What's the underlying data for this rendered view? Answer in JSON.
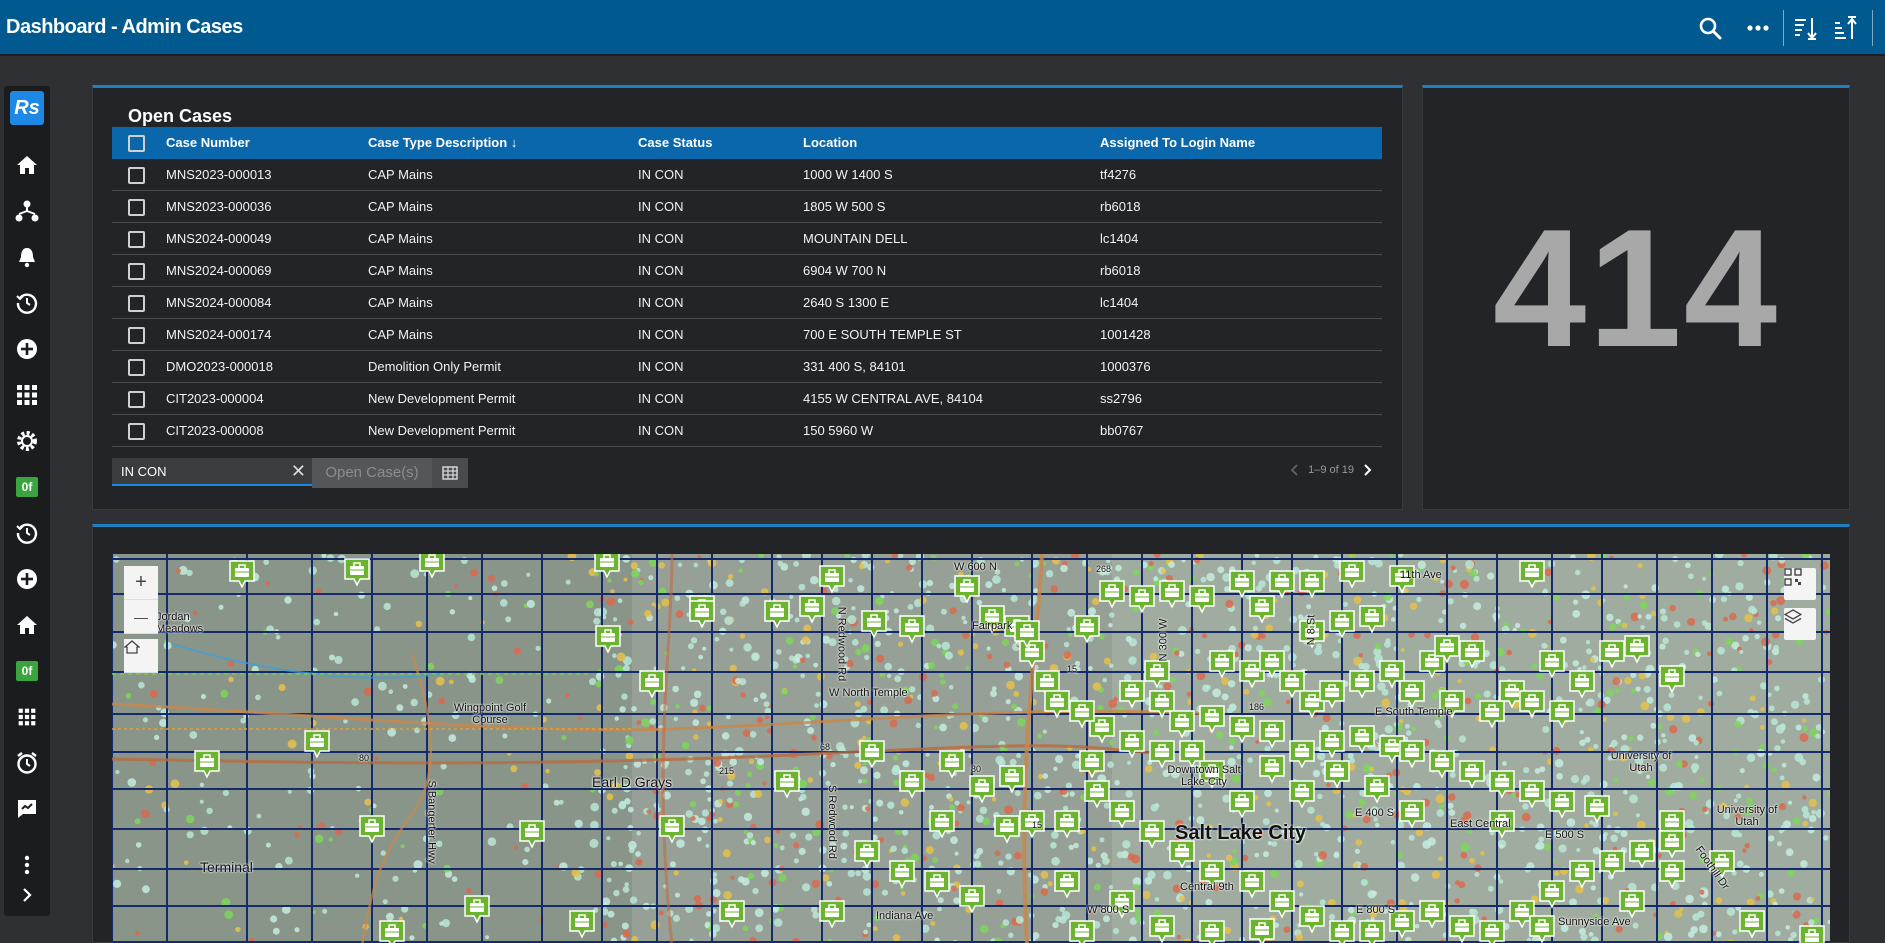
{
  "header": {
    "title": "Dashboard - Admin Cases",
    "icons": [
      "search-icon",
      "more-icon",
      "sort-descending-icon",
      "sort-ascending-icon"
    ]
  },
  "rail": {
    "logo": "Rs",
    "badge_1": "0f",
    "badge_2": "0f"
  },
  "cases": {
    "title": "Open Cases",
    "columns": {
      "number": "Case Number",
      "type": "Case Type Description",
      "sort_arrow": "↓",
      "status": "Case Status",
      "location": "Location",
      "assigned": "Assigned To Login Name"
    },
    "rows": [
      {
        "number": "MNS2023-000013",
        "type": "CAP Mains",
        "status": "IN CON",
        "location": "1000 W 1400 S",
        "assigned": "tf4276"
      },
      {
        "number": "MNS2023-000036",
        "type": "CAP Mains",
        "status": "IN CON",
        "location": "1805 W 500 S",
        "assigned": "rb6018"
      },
      {
        "number": "MNS2024-000049",
        "type": "CAP Mains",
        "status": "IN CON",
        "location": "MOUNTAIN DELL",
        "assigned": "lc1404"
      },
      {
        "number": "MNS2024-000069",
        "type": "CAP Mains",
        "status": "IN CON",
        "location": "6904 W 700 N",
        "assigned": "rb6018"
      },
      {
        "number": "MNS2024-000084",
        "type": "CAP Mains",
        "status": "IN CON",
        "location": "2640 S 1300 E",
        "assigned": "lc1404"
      },
      {
        "number": "MNS2024-000174",
        "type": "CAP Mains",
        "status": "IN CON",
        "location": "700 E SOUTH TEMPLE ST",
        "assigned": "1001428"
      },
      {
        "number": "DMO2023-000018",
        "type": "Demolition Only Permit",
        "status": "IN CON",
        "location": "331 400 S, 84101",
        "assigned": "1000376"
      },
      {
        "number": "CIT2023-000004",
        "type": "New Development Permit",
        "status": "IN CON",
        "location": "4155 W CENTRAL AVE, 84104",
        "assigned": "ss2796"
      },
      {
        "number": "CIT2023-000008",
        "type": "New Development Permit",
        "status": "IN CON",
        "location": "150 5960 W",
        "assigned": "bb0767"
      }
    ],
    "filter_value": "IN CON",
    "clear_symbol": "✕",
    "open_button": "Open Case(s)",
    "pager_text": "1–9 of 19"
  },
  "count": {
    "value": "414"
  },
  "map": {
    "zoom_in": "+",
    "zoom_out": "—",
    "labels": {
      "jordan_meadows": "Jordan Meadows",
      "w600n": "W 600 N",
      "hwy268": "268",
      "w11th": "11th Ave",
      "fairpark": "Fairpark",
      "n300w": "N 300 W",
      "n8st": "N 8 St",
      "hwy15a": "15",
      "w_north_temple": "W North Temple",
      "redwood_n": "N Redwood Rd",
      "wingpoint": "Wingpoint Golf Course",
      "hwy186": "186",
      "e_south_temple": "E South Temple",
      "hwy68": "68",
      "i80a": "80",
      "i80b": "80",
      "i215": "215",
      "university": "University of Utah",
      "downtown": "Downtown Salt Lake City",
      "earl_d_grays": "Earl D Grays",
      "salt_lake_city": "Salt Lake City",
      "e400s": "E 400 S",
      "east_central": "East Central",
      "e500s": "E 500 S",
      "university2": "University of Utah",
      "foothill": "Foothill Dr",
      "bangerter": "S Bangerter Hwy",
      "redwood_s": "S Redwood Rd",
      "hwy15b": "15",
      "terminal": "Terminal",
      "central9th": "Central 9th",
      "w800s": "W 800 S",
      "e800s": "E 800 S",
      "indiana": "Indiana Ave",
      "sunnyside": "Sunnyside Ave"
    }
  }
}
